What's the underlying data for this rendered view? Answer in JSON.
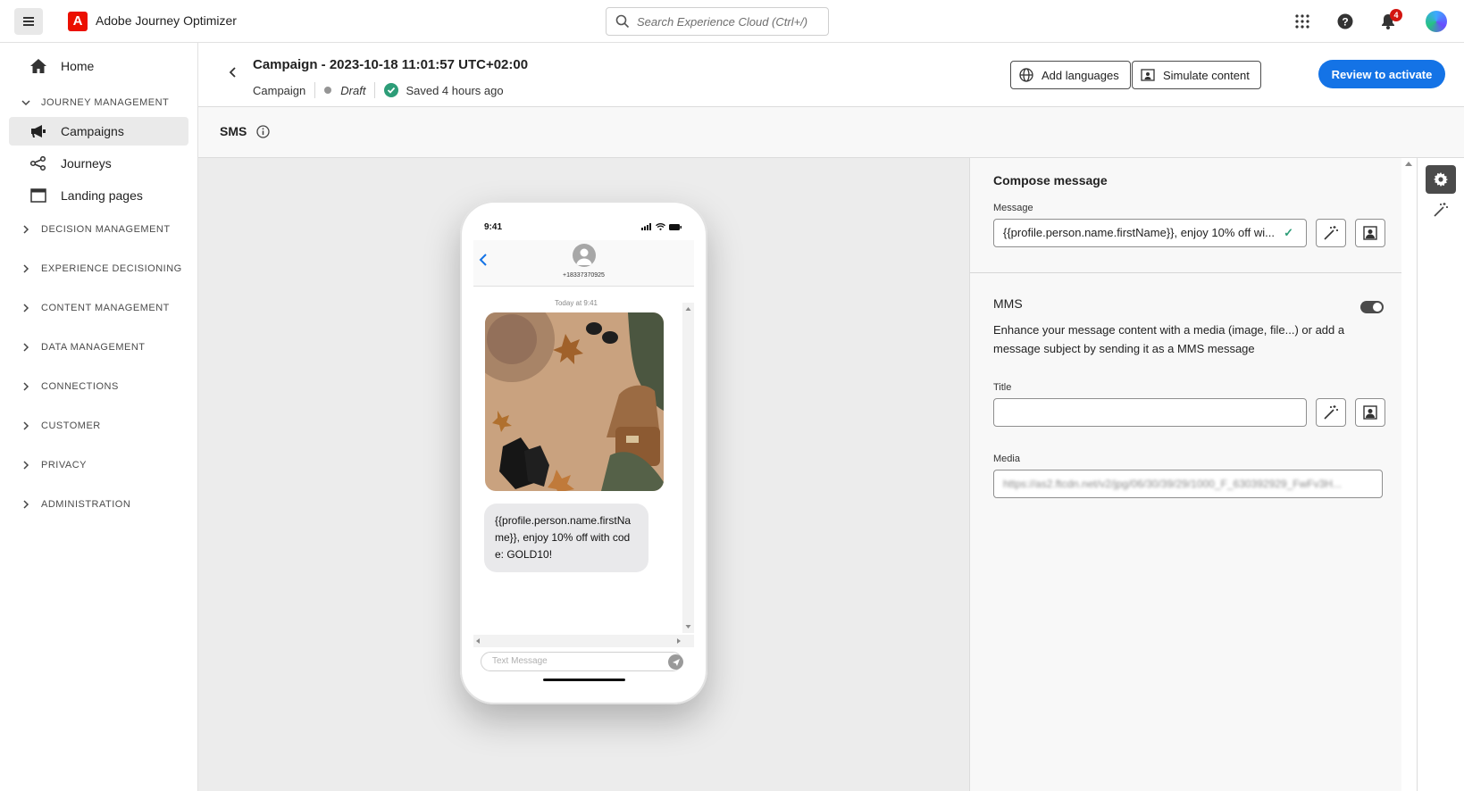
{
  "topbar": {
    "app_title": "Adobe Journey Optimizer",
    "search_placeholder": "Search Experience Cloud (Ctrl+/)",
    "notifications_count": "4"
  },
  "sidebar": {
    "home": "Home",
    "journey_management": "JOURNEY MANAGEMENT",
    "campaigns": "Campaigns",
    "journeys": "Journeys",
    "landing_pages": "Landing pages",
    "sections": [
      "DECISION MANAGEMENT",
      "EXPERIENCE DECISIONING",
      "CONTENT MANAGEMENT",
      "DATA MANAGEMENT",
      "CONNECTIONS",
      "CUSTOMER",
      "PRIVACY",
      "ADMINISTRATION"
    ]
  },
  "header": {
    "title": "Campaign - 2023-10-18 11:01:57 UTC+02:00",
    "type": "Campaign",
    "status": "Draft",
    "saved": "Saved 4 hours ago",
    "add_languages": "Add languages",
    "simulate_content": "Simulate content",
    "review_to_activate": "Review to activate"
  },
  "channel": {
    "title": "SMS"
  },
  "preview": {
    "time": "9:41",
    "contact_number": "+18337370925",
    "timestamp": "Today at 9:41",
    "message_text": "{{profile.person.name.firstName}}, enjoy 10% off with code: GOLD10!",
    "input_placeholder": "Text Message"
  },
  "panel": {
    "compose_title": "Compose message",
    "message_label": "Message",
    "message_value": "{{profile.person.name.firstName}}, enjoy 10% off wi...",
    "mms_title": "MMS",
    "mms_enabled": true,
    "mms_description": "Enhance your message content with a media (image, file...) or add a message subject by sending it as a MMS message",
    "title_label": "Title",
    "title_value": "",
    "media_label": "Media",
    "media_value": "https://as2.ftcdn.net/v2/jpg/06/30/39/29/1000_F_630392929_FwFv3H..."
  },
  "colors": {
    "primary": "#1473e6",
    "adobe_red": "#eb1000",
    "success": "#2d9d78",
    "notification": "#d31510"
  }
}
